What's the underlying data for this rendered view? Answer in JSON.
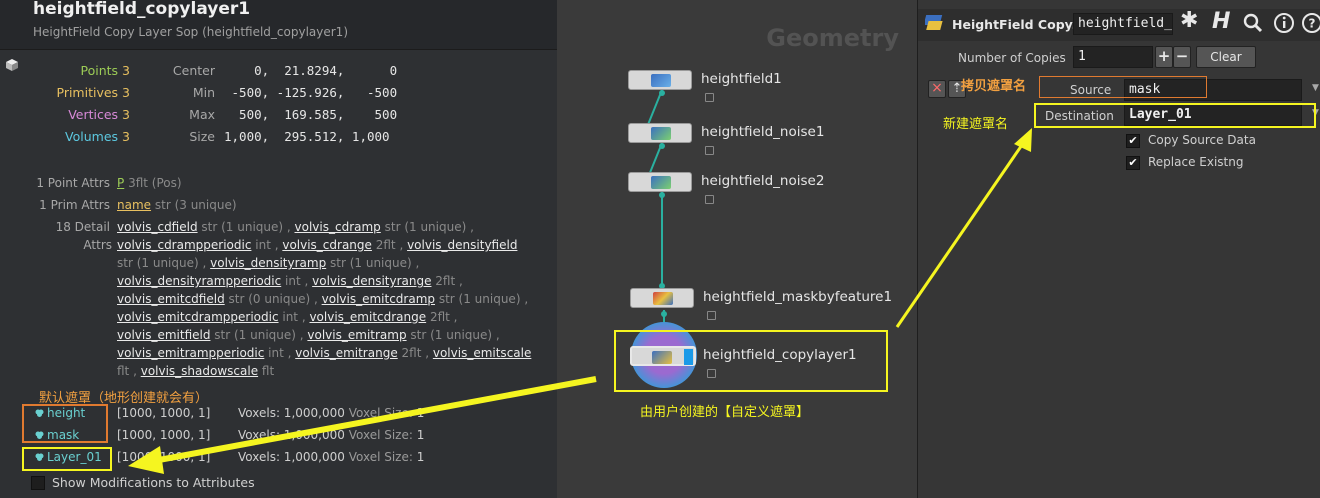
{
  "info": {
    "title": "heightfield_copylayer1",
    "subtitle": "HeightField Copy Layer Sop (heightfield_copylayer1)",
    "stats": [
      {
        "label": "Points",
        "value": "3",
        "color": "#9ccc56"
      },
      {
        "label": "Primitives",
        "value": "3",
        "color": "#e8c060"
      },
      {
        "label": "Vertices",
        "value": "3",
        "color": "#d88ad8"
      },
      {
        "label": "Volumes",
        "value": "3",
        "color": "#5cc8e0"
      }
    ],
    "geo": [
      {
        "label": "Center",
        "value": "    0,  21.8294,      0"
      },
      {
        "label": "Min",
        "value": " -500, -125.926,   -500"
      },
      {
        "label": "Max",
        "value": "  500,  169.585,    500"
      },
      {
        "label": "Size",
        "value": "1,000,  295.512, 1,000"
      }
    ],
    "point_attrs_label": "1 Point Attrs",
    "point_attr_name": "P",
    "point_attr_type": "3flt (Pos)",
    "prim_attrs_label": "1 Prim Attrs",
    "prim_attr_name": "name",
    "prim_attr_type": "str (3 unique)",
    "detail_attrs_label": "18 Detail",
    "detail_attrs_label2": "Attrs",
    "detail_lines": [
      [
        {
          "n": "volvis_cdfield",
          "t": " str (1 unique) ,"
        },
        {
          "n": "volvis_cdramp",
          "t": " str (1 unique) ,"
        }
      ],
      [
        {
          "n": "volvis_cdrampperiodic",
          "t": " int ,"
        },
        {
          "n": "volvis_cdrange",
          "t": " 2flt ,"
        },
        {
          "n": "volvis_densityfield",
          "t": ""
        }
      ],
      [
        {
          "n": "",
          "t": "str (1 unique) ,"
        },
        {
          "n": "volvis_densityramp",
          "t": " str (1 unique) ,"
        }
      ],
      [
        {
          "n": "volvis_densityrampperiodic",
          "t": " int ,"
        },
        {
          "n": "volvis_densityrange",
          "t": " 2flt ,"
        }
      ],
      [
        {
          "n": "volvis_emitcdfield",
          "t": " str (0 unique) ,"
        },
        {
          "n": "volvis_emitcdramp",
          "t": " str (1 unique) ,"
        }
      ],
      [
        {
          "n": "volvis_emitcdrampperiodic",
          "t": " int ,"
        },
        {
          "n": "volvis_emitcdrange",
          "t": " 2flt ,"
        }
      ],
      [
        {
          "n": "volvis_emitfield",
          "t": " str (1 unique) ,"
        },
        {
          "n": "volvis_emitramp",
          "t": " str (1 unique) ,"
        }
      ],
      [
        {
          "n": "volvis_emitrampperiodic",
          "t": " int ,"
        },
        {
          "n": "volvis_emitrange",
          "t": " 2flt ,"
        },
        {
          "n": "volvis_emitscale",
          "t": ""
        }
      ],
      [
        {
          "n": "",
          "t": "flt ,"
        },
        {
          "n": "volvis_shadowscale",
          "t": " flt"
        }
      ]
    ],
    "volumes": [
      {
        "name": "height",
        "dims": "[1000, 1000, 1]",
        "voxels": "Voxels: 1,000,000",
        "vsize_label": "Voxel Size:",
        "vsize": "1"
      },
      {
        "name": "mask",
        "dims": "[1000, 1000, 1]",
        "voxels": "Voxels: 1,000,000",
        "vsize_label": "Voxel Size:",
        "vsize": "1"
      },
      {
        "name": "Layer_01",
        "dims": "[1000, 1000, 1]",
        "voxels": "Voxels: 1,000,000",
        "vsize_label": "Voxel Size:",
        "vsize": "1"
      }
    ],
    "show_mods_label": "Show Modifications to Attributes"
  },
  "network": {
    "context_label": "Geometry",
    "nodes": [
      {
        "name": "heightfield1"
      },
      {
        "name": "heightfield_noise1"
      },
      {
        "name": "heightfield_noise2"
      },
      {
        "name": "heightfield_maskbyfeature1"
      },
      {
        "name": "heightfield_copylayer1"
      }
    ]
  },
  "params": {
    "node_type": "HeightField Copy...",
    "node_name": "heightfield_c",
    "num_copies_label": "Number of Copies",
    "num_copies_value": "1",
    "plus_label": "+",
    "minus_label": "−",
    "clear_label": "Clear",
    "close_label": "×",
    "source_label": "Source",
    "source_value": "mask",
    "dest_label": "Destination",
    "dest_value": "Layer_01",
    "copy_source_label": "Copy Source Data",
    "replace_label": "Replace Existng"
  },
  "annotations": {
    "default_mask": "默认遮罩（地形创建就会有）",
    "user_mask": "由用户创建的【自定义遮罩】",
    "copy_mask_name": "拷贝遮罩名",
    "new_mask_name": "新建遮罩名"
  },
  "colors": {
    "annotation_yellow": "#f5f520",
    "annotation_orange": "#e07a30",
    "wire_teal": "#2ab0a0"
  }
}
